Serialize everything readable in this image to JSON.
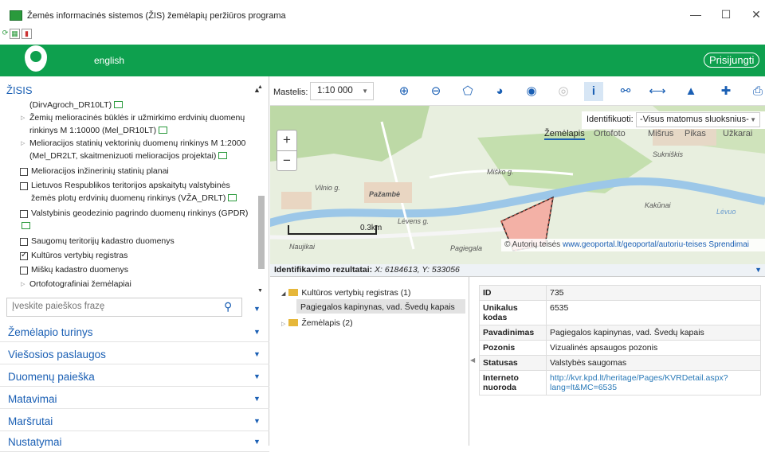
{
  "window": {
    "title": "Žemės informacinės sistemos (ŽIS) žemėlapių peržiūros programa",
    "minimize": "—",
    "maximize": "☐",
    "close": "✕"
  },
  "header": {
    "language_link": "english",
    "login_button": "Prisijungti",
    "brand_color": "#0ea04e"
  },
  "sidebar": {
    "title": "ŽISIS",
    "tree": [
      {
        "text": "(DirvAgroch_DR10LT)",
        "kind": "cont"
      },
      {
        "text": "Žemių melioracinės būklės ir užmirkimo erdvinių duomenų",
        "kind": "expand"
      },
      {
        "text": "rinkinys M 1:10000 (Mel_DR10LT)",
        "kind": "cont"
      },
      {
        "text": "Melioracijos statinių vektorinių duomenų rinkinys M 1:2000",
        "kind": "expand"
      },
      {
        "text": "(Mel_DR2LT, skaitmenizuoti melioracijos projektai)",
        "kind": "cont"
      },
      {
        "text": "Melioracijos inžinerinių statinių planai",
        "kind": "check"
      },
      {
        "text": "Lietuvos Respublikos teritorijos apskaitytų valstybinės",
        "kind": "check"
      },
      {
        "text": "žemės plotų erdvinių duomenų rinkinys (VŽA_DRLT)",
        "kind": "cont"
      },
      {
        "text": "Valstybinis geodezinio pagrindo duomenų rinkinys (GPDR)",
        "kind": "check"
      },
      {
        "text": "",
        "kind": "cont"
      },
      {
        "text": "Saugomų teritorijų kadastro duomenys",
        "kind": "check"
      },
      {
        "text": "Kultūros vertybių registras",
        "kind": "checked"
      },
      {
        "text": "Miškų kadastro duomenys",
        "kind": "check"
      },
      {
        "text": "Ortofotografiniai žemėlapiai",
        "kind": "expand"
      }
    ],
    "search_placeholder": "Įveskite paieškos frazę",
    "sections": [
      "Žemėlapio turinys",
      "Viešosios paslaugos",
      "Duomenų paieška",
      "Matavimai",
      "Maršrutai",
      "Nustatymai"
    ]
  },
  "toolbar": {
    "scale_label": "Mastelis:",
    "scale_value": "1:10 000",
    "identify_label": "Identifikuoti:",
    "identify_value": "-Visus matomus sluoksnius-"
  },
  "map": {
    "tabs": [
      "Žemėlapis",
      "Ortofoto",
      "Mišrus",
      "Pikas",
      "Užkarai"
    ],
    "scalebar_label": "0.3km",
    "place_labels": [
      "Sukniškis",
      "Miško g.",
      "Pažambė",
      "Vilnio g.",
      "Lėvens g.",
      "Kakūnai",
      "Lėvuo",
      "Naujikai",
      "Pagiegala"
    ],
    "attribution_prefix": "© Autorių teisės",
    "attribution_link": "www.geoportal.lt/geoportal/autoriu-teises",
    "attribution_more": "Sprendimai"
  },
  "results": {
    "header_label": "Identifikavimo rezultatai:",
    "coords": "X: 6184613, Y: 533056",
    "tree": [
      {
        "text": "Kultūros vertybių registras (1)",
        "level": 0
      },
      {
        "text": "Pagiegalos kapinynas, vad. Švedų kapais",
        "level": 1
      },
      {
        "text": "Žemėlapis (2)",
        "level": 0
      }
    ],
    "attributes": [
      {
        "key": "ID",
        "value": "735"
      },
      {
        "key": "Unikalus kodas",
        "value": "6535"
      },
      {
        "key": "Pavadinimas",
        "value": "Pagiegalos kapinynas, vad. Švedų kapais"
      },
      {
        "key": "Pozonis",
        "value": "Vizualinės apsaugos pozonis"
      },
      {
        "key": "Statusas",
        "value": "Valstybės saugomas"
      },
      {
        "key": "Interneto nuoroda",
        "value": "http://kvr.kpd.lt/heritage/Pages/KVRDetail.aspx?lang=lt&MC=6535"
      }
    ]
  }
}
